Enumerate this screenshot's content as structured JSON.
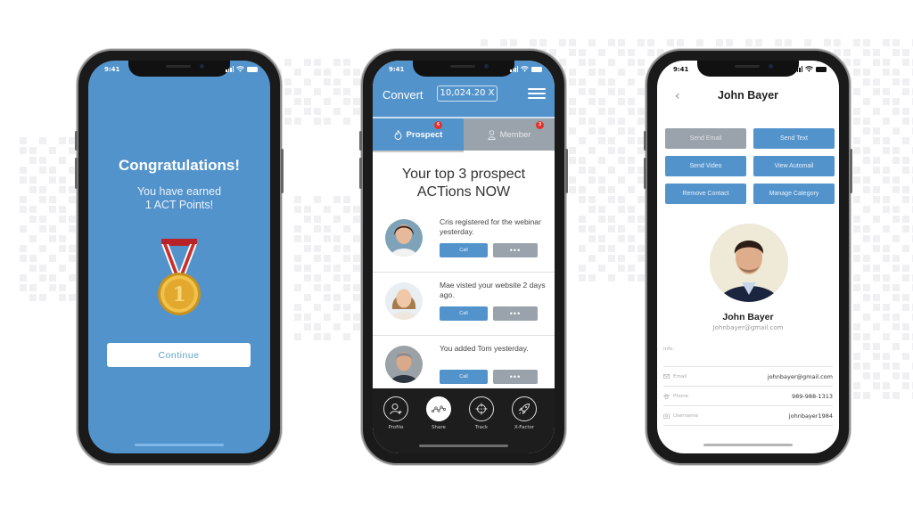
{
  "colors": {
    "brand_blue": "#5393cc",
    "gray_button": "#9aa3ab",
    "badge_red": "#e2322c",
    "nav_dark": "#1d1d1d"
  },
  "phones": {
    "congrats": {
      "status_time": "9:41",
      "title": "Congratulations!",
      "subtitle_line1": "You have earned",
      "subtitle_line2": "1 ACT Points!",
      "medal_icon": "gold-medal-icon",
      "continue_label": "Continue"
    },
    "prospects": {
      "status_time": "9:41",
      "brand": "Convert",
      "balance": "10,024.20 X",
      "tabs": [
        {
          "label": "Prospect",
          "badge": "6",
          "icon": "flame-icon",
          "active": true
        },
        {
          "label": "Member",
          "badge": "3",
          "icon": "person-icon",
          "active": false
        }
      ],
      "heading_line1": "Your top 3 prospect",
      "heading_line2": "ACTions NOW",
      "actions": [
        {
          "text": "Cris registered for the webinar yesterday.",
          "call_label": "Call",
          "more_label": "•••"
        },
        {
          "text": "Mae visted your website 2 days ago.",
          "call_label": "Call",
          "more_label": "•••"
        },
        {
          "text": "You added Tom yesterday.",
          "call_label": "Call",
          "more_label": "•••"
        }
      ],
      "bottom_nav": [
        {
          "label": "Profile",
          "icon": "add-user-icon",
          "active": false
        },
        {
          "label": "Share",
          "icon": "share-network-icon",
          "active": true
        },
        {
          "label": "Track",
          "icon": "crosshair-icon",
          "active": false
        },
        {
          "label": "X-Factor",
          "icon": "rocket-icon",
          "active": false
        }
      ]
    },
    "contact": {
      "status_time": "9:41",
      "back_glyph": "‹",
      "title": "John Bayer",
      "buttons": [
        {
          "label": "Send Email",
          "disabled": true
        },
        {
          "label": "Send Text",
          "disabled": false
        },
        {
          "label": "Send Video",
          "disabled": false
        },
        {
          "label": "View Automail",
          "disabled": false
        },
        {
          "label": "Remove Contact",
          "disabled": false
        },
        {
          "label": "Manage Category",
          "disabled": false
        }
      ],
      "name": "John Bayer",
      "email_sub": "Johnbayer@gmail.com",
      "info_label": "Info:",
      "info_rows": [
        {
          "key": "Email",
          "value": "johnbayer@gmail.com",
          "icon": "envelope-icon"
        },
        {
          "key": "Phone",
          "value": "989-988-1313",
          "icon": "phone-icon"
        },
        {
          "key": "Username",
          "value": "johnbayer1984",
          "icon": "user-badge-icon"
        }
      ]
    }
  }
}
